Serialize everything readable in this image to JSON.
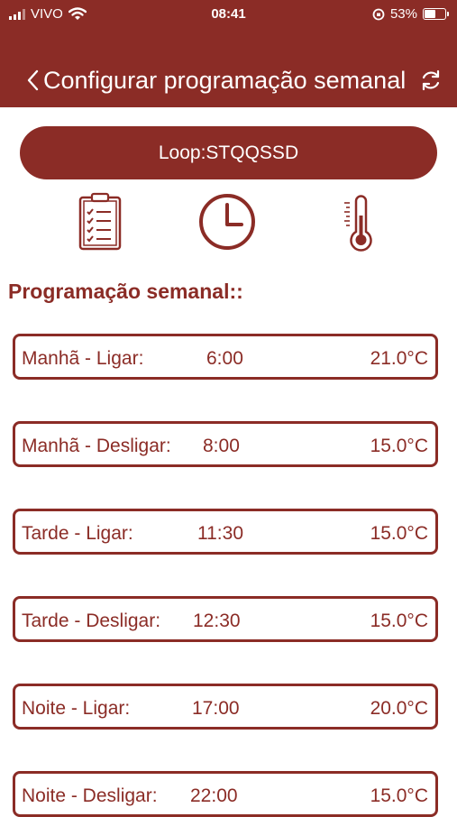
{
  "status_bar": {
    "carrier": "VIVO",
    "time": "08:41",
    "battery": "53%"
  },
  "header": {
    "title": "Configurar programação semanal"
  },
  "loop_button": {
    "label": "Loop:STQQSSD"
  },
  "toolbar_icons": [
    "clipboard-checklist-icon",
    "clock-icon",
    "thermometer-icon"
  ],
  "section_title": "Programação semanal::",
  "schedule": [
    {
      "label": "Manhã - Ligar:",
      "time": "6:00",
      "temp": "21.0°C"
    },
    {
      "label": "Manhã - Desligar:",
      "time": "8:00",
      "temp": "15.0°C"
    },
    {
      "label": "Tarde - Ligar:",
      "time": "11:30",
      "temp": "15.0°C"
    },
    {
      "label": "Tarde - Desligar:",
      "time": "12:30",
      "temp": "15.0°C"
    },
    {
      "label": "Noite - Ligar:",
      "time": "17:00",
      "temp": "20.0°C"
    },
    {
      "label": "Noite - Desligar:",
      "time": "22:00",
      "temp": "15.0°C"
    }
  ],
  "colors": {
    "primary": "#8b2c26",
    "background": "#ffffff",
    "on_primary": "#ffffff"
  }
}
